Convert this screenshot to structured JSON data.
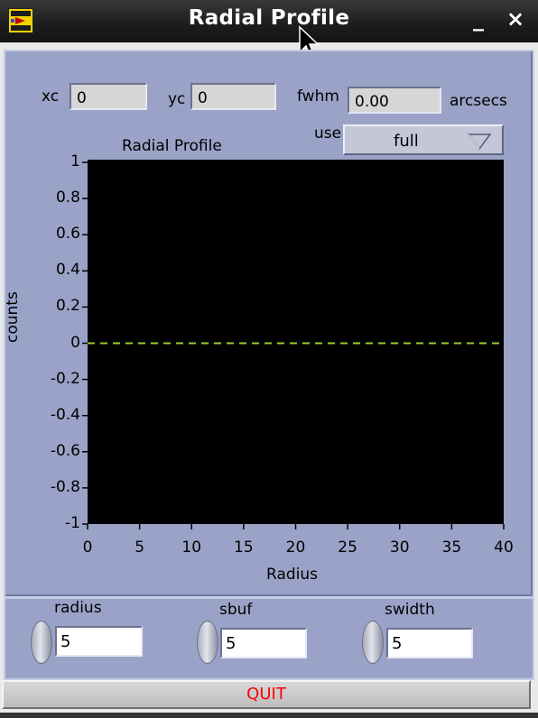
{
  "window": {
    "title": "Radial Profile",
    "minimize_symbol": "_",
    "close_symbol": "×"
  },
  "fields": {
    "xc_label": "xc",
    "xc_value": "0",
    "yc_label": "yc",
    "yc_value": "0",
    "fwhm_label": "fwhm",
    "fwhm_value": "0.00",
    "fwhm_unit": "arcsecs",
    "use_label": "use",
    "use_value": "full"
  },
  "chart_data": {
    "type": "line",
    "title": "Radial Profile",
    "xlabel": "Radius",
    "ylabel": "counts",
    "xlim": [
      0,
      40
    ],
    "ylim": [
      -1,
      1
    ],
    "x_ticks": [
      "0",
      "5",
      "10",
      "15",
      "20",
      "25",
      "30",
      "35",
      "40"
    ],
    "y_ticks": [
      "1",
      "0.8",
      "0.6",
      "0.4",
      "0.2",
      "0",
      "-0.2",
      "-0.4",
      "-0.6",
      "-0.8",
      "-1"
    ],
    "series": [
      {
        "x": [
          0,
          40
        ],
        "y": [
          0,
          0
        ],
        "color": "#9acd32",
        "style": "dashed"
      }
    ],
    "background": "#000000",
    "grid": false
  },
  "controls": {
    "radius_label": "radius",
    "radius_value": "5",
    "sbuf_label": "sbuf",
    "sbuf_value": "5",
    "swidth_label": "swidth",
    "swidth_value": "5"
  },
  "buttons": {
    "quit_label": "QUIT"
  },
  "icons": {
    "app": "labview-app-icon",
    "cursor": "mouse-pointer-icon",
    "select_arrow": "triangle-down-icon"
  },
  "colors": {
    "panel": "#9aa3c7",
    "quit_text": "#ff0000",
    "trace": "#9acd32"
  }
}
